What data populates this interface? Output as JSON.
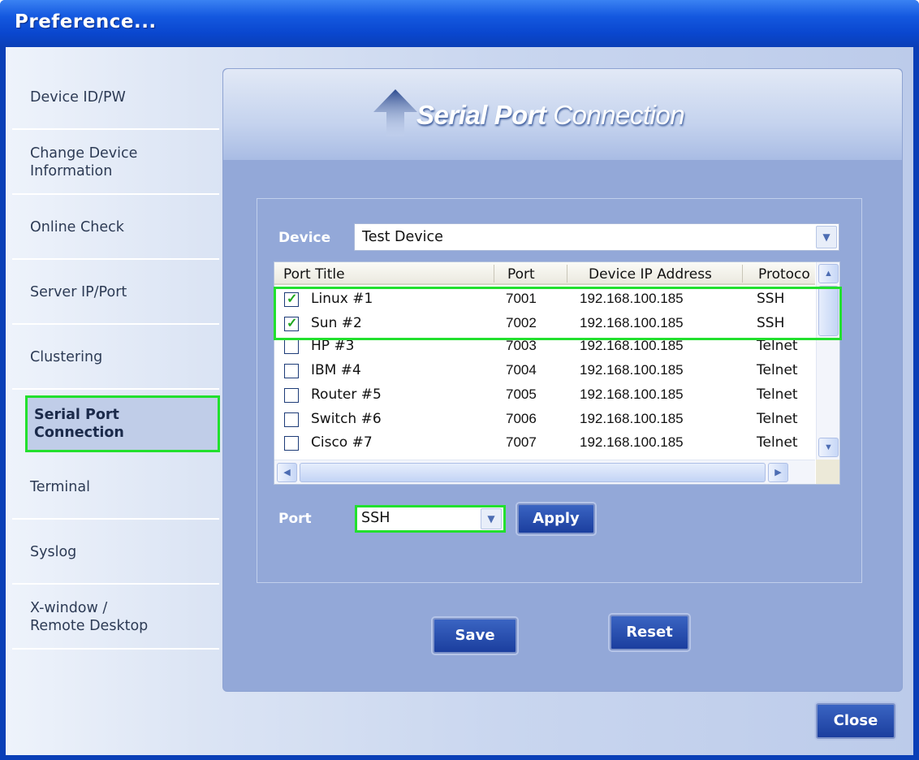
{
  "window": {
    "title": "Preference..."
  },
  "sidebar": {
    "items": [
      {
        "label": "Device ID/PW"
      },
      {
        "label": "Change Device\nInformation"
      },
      {
        "label": "Online Check"
      },
      {
        "label": "Server IP/Port"
      },
      {
        "label": "Clustering"
      },
      {
        "label": "Serial Port\nConnection"
      },
      {
        "label": "Terminal"
      },
      {
        "label": "Syslog"
      },
      {
        "label": "X-window /\nRemote Desktop"
      }
    ],
    "active": "Serial Port Connection"
  },
  "panel": {
    "heading_bold": "Serial Port",
    "heading_rest": " Connection",
    "device_label": "Device",
    "device_value": "Test Device",
    "port_label": "Port",
    "port_value": "SSH",
    "apply_label": "Apply",
    "save_label": "Save",
    "reset_label": "Reset"
  },
  "table": {
    "columns": [
      "Port Title",
      "Port",
      "Device IP Address",
      "Protocol"
    ],
    "rows": [
      {
        "checked": true,
        "title": "Linux #1",
        "port": "7001",
        "ip": "192.168.100.185",
        "protocol": "SSH"
      },
      {
        "checked": true,
        "title": "Sun  #2",
        "port": "7002",
        "ip": "192.168.100.185",
        "protocol": "SSH"
      },
      {
        "checked": false,
        "title": "HP  #3",
        "port": "7003",
        "ip": "192.168.100.185",
        "protocol": "Telnet"
      },
      {
        "checked": false,
        "title": "IBM  #4",
        "port": "7004",
        "ip": "192.168.100.185",
        "protocol": "Telnet"
      },
      {
        "checked": false,
        "title": "Router  #5",
        "port": "7005",
        "ip": "192.168.100.185",
        "protocol": "Telnet"
      },
      {
        "checked": false,
        "title": "Switch #6",
        "port": "7006",
        "ip": "192.168.100.185",
        "protocol": "Telnet"
      },
      {
        "checked": false,
        "title": "Cisco  #7",
        "port": "7007",
        "ip": "192.168.100.185",
        "protocol": "Telnet"
      }
    ]
  },
  "footer": {
    "close_label": "Close"
  },
  "icons": {
    "up-arrow": "up-arrow-icon",
    "scroll-up": "▲",
    "scroll-down": "▼",
    "scroll-left": "◀",
    "scroll-right": "▶",
    "dropdown": "▼"
  },
  "colors": {
    "titlebar": "#0a47cf",
    "panel": "#93a8d8",
    "button": "#1b3e9e",
    "highlight": "#22e02e"
  }
}
